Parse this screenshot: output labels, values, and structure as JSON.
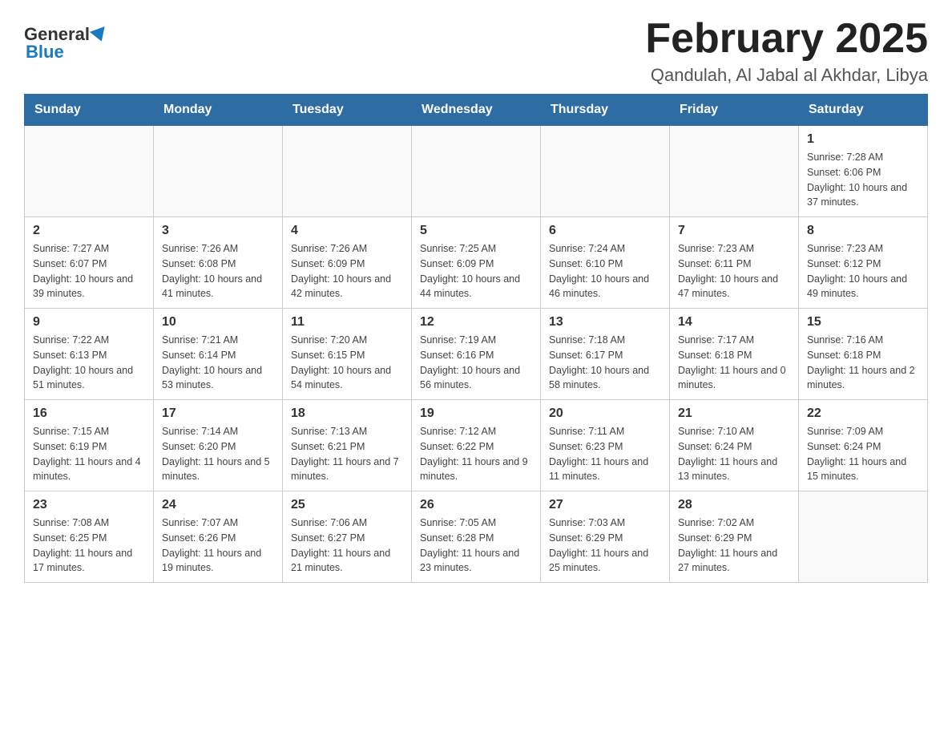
{
  "logo": {
    "general": "General",
    "blue": "Blue"
  },
  "title": "February 2025",
  "subtitle": "Qandulah, Al Jabal al Akhdar, Libya",
  "days_header": [
    "Sunday",
    "Monday",
    "Tuesday",
    "Wednesday",
    "Thursday",
    "Friday",
    "Saturday"
  ],
  "weeks": [
    [
      {
        "day": "",
        "info": ""
      },
      {
        "day": "",
        "info": ""
      },
      {
        "day": "",
        "info": ""
      },
      {
        "day": "",
        "info": ""
      },
      {
        "day": "",
        "info": ""
      },
      {
        "day": "",
        "info": ""
      },
      {
        "day": "1",
        "info": "Sunrise: 7:28 AM\nSunset: 6:06 PM\nDaylight: 10 hours and 37 minutes."
      }
    ],
    [
      {
        "day": "2",
        "info": "Sunrise: 7:27 AM\nSunset: 6:07 PM\nDaylight: 10 hours and 39 minutes."
      },
      {
        "day": "3",
        "info": "Sunrise: 7:26 AM\nSunset: 6:08 PM\nDaylight: 10 hours and 41 minutes."
      },
      {
        "day": "4",
        "info": "Sunrise: 7:26 AM\nSunset: 6:09 PM\nDaylight: 10 hours and 42 minutes."
      },
      {
        "day": "5",
        "info": "Sunrise: 7:25 AM\nSunset: 6:09 PM\nDaylight: 10 hours and 44 minutes."
      },
      {
        "day": "6",
        "info": "Sunrise: 7:24 AM\nSunset: 6:10 PM\nDaylight: 10 hours and 46 minutes."
      },
      {
        "day": "7",
        "info": "Sunrise: 7:23 AM\nSunset: 6:11 PM\nDaylight: 10 hours and 47 minutes."
      },
      {
        "day": "8",
        "info": "Sunrise: 7:23 AM\nSunset: 6:12 PM\nDaylight: 10 hours and 49 minutes."
      }
    ],
    [
      {
        "day": "9",
        "info": "Sunrise: 7:22 AM\nSunset: 6:13 PM\nDaylight: 10 hours and 51 minutes."
      },
      {
        "day": "10",
        "info": "Sunrise: 7:21 AM\nSunset: 6:14 PM\nDaylight: 10 hours and 53 minutes."
      },
      {
        "day": "11",
        "info": "Sunrise: 7:20 AM\nSunset: 6:15 PM\nDaylight: 10 hours and 54 minutes."
      },
      {
        "day": "12",
        "info": "Sunrise: 7:19 AM\nSunset: 6:16 PM\nDaylight: 10 hours and 56 minutes."
      },
      {
        "day": "13",
        "info": "Sunrise: 7:18 AM\nSunset: 6:17 PM\nDaylight: 10 hours and 58 minutes."
      },
      {
        "day": "14",
        "info": "Sunrise: 7:17 AM\nSunset: 6:18 PM\nDaylight: 11 hours and 0 minutes."
      },
      {
        "day": "15",
        "info": "Sunrise: 7:16 AM\nSunset: 6:18 PM\nDaylight: 11 hours and 2 minutes."
      }
    ],
    [
      {
        "day": "16",
        "info": "Sunrise: 7:15 AM\nSunset: 6:19 PM\nDaylight: 11 hours and 4 minutes."
      },
      {
        "day": "17",
        "info": "Sunrise: 7:14 AM\nSunset: 6:20 PM\nDaylight: 11 hours and 5 minutes."
      },
      {
        "day": "18",
        "info": "Sunrise: 7:13 AM\nSunset: 6:21 PM\nDaylight: 11 hours and 7 minutes."
      },
      {
        "day": "19",
        "info": "Sunrise: 7:12 AM\nSunset: 6:22 PM\nDaylight: 11 hours and 9 minutes."
      },
      {
        "day": "20",
        "info": "Sunrise: 7:11 AM\nSunset: 6:23 PM\nDaylight: 11 hours and 11 minutes."
      },
      {
        "day": "21",
        "info": "Sunrise: 7:10 AM\nSunset: 6:24 PM\nDaylight: 11 hours and 13 minutes."
      },
      {
        "day": "22",
        "info": "Sunrise: 7:09 AM\nSunset: 6:24 PM\nDaylight: 11 hours and 15 minutes."
      }
    ],
    [
      {
        "day": "23",
        "info": "Sunrise: 7:08 AM\nSunset: 6:25 PM\nDaylight: 11 hours and 17 minutes."
      },
      {
        "day": "24",
        "info": "Sunrise: 7:07 AM\nSunset: 6:26 PM\nDaylight: 11 hours and 19 minutes."
      },
      {
        "day": "25",
        "info": "Sunrise: 7:06 AM\nSunset: 6:27 PM\nDaylight: 11 hours and 21 minutes."
      },
      {
        "day": "26",
        "info": "Sunrise: 7:05 AM\nSunset: 6:28 PM\nDaylight: 11 hours and 23 minutes."
      },
      {
        "day": "27",
        "info": "Sunrise: 7:03 AM\nSunset: 6:29 PM\nDaylight: 11 hours and 25 minutes."
      },
      {
        "day": "28",
        "info": "Sunrise: 7:02 AM\nSunset: 6:29 PM\nDaylight: 11 hours and 27 minutes."
      },
      {
        "day": "",
        "info": ""
      }
    ]
  ]
}
